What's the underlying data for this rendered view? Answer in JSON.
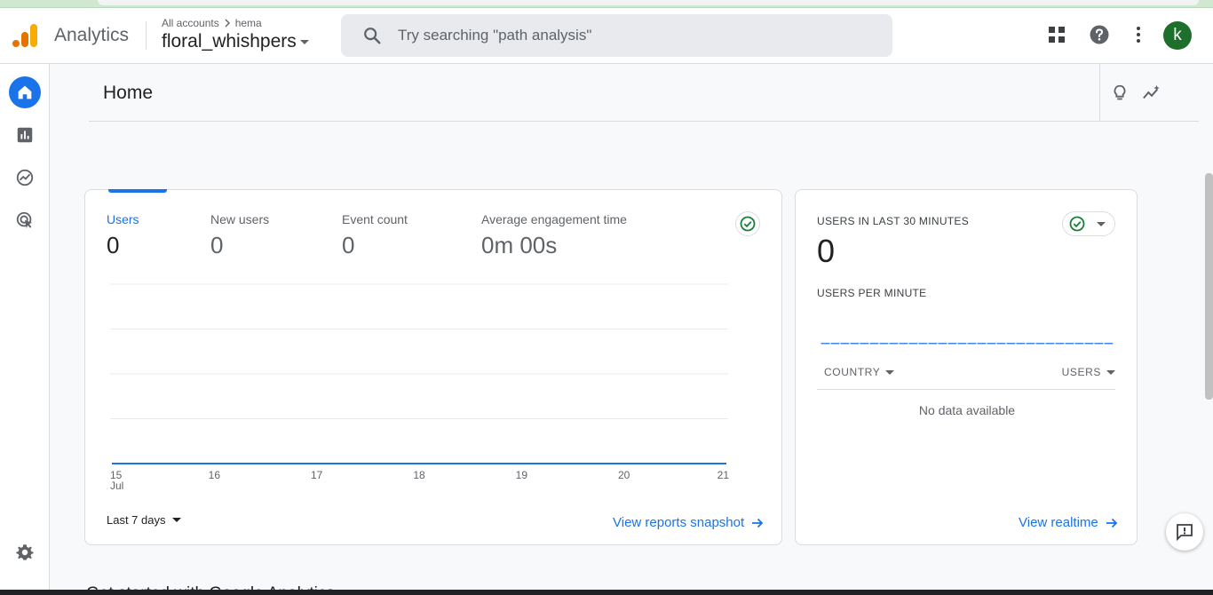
{
  "header": {
    "app_title": "Analytics",
    "breadcrumb": {
      "account": "All accounts",
      "sub": "hema"
    },
    "property": "floral_whishpers",
    "search": {
      "placeholder": "Try searching \"path analysis\""
    },
    "avatar_initial": "k"
  },
  "nav": {
    "items": [
      "home-icon",
      "reports-icon",
      "explore-icon",
      "advertising-icon"
    ],
    "settings": "gear-icon"
  },
  "page": {
    "title": "Home"
  },
  "overview": {
    "metrics": [
      {
        "label": "Users",
        "value": "0"
      },
      {
        "label": "New users",
        "value": "0"
      },
      {
        "label": "Event count",
        "value": "0"
      },
      {
        "label": "Average engagement time",
        "value": "0m 00s"
      }
    ],
    "range_label": "Last 7 days",
    "link": "View reports snapshot"
  },
  "chart_data": {
    "type": "line",
    "x": [
      "15",
      "16",
      "17",
      "18",
      "19",
      "20",
      "21"
    ],
    "x_sublabel": "Jul",
    "series": [
      {
        "values": [
          0,
          0,
          0,
          0,
          0,
          0,
          0
        ]
      }
    ],
    "grid": true,
    "color": "#1a73e8"
  },
  "realtime": {
    "title": "USERS IN LAST 30 MINUTES",
    "value": "0",
    "subtitle": "USERS PER MINUTE",
    "columns": [
      "COUNTRY",
      "USERS"
    ],
    "no_data": "No data available",
    "link": "View realtime"
  },
  "footer": {
    "partial_heading": "Get started with Google Analytics"
  },
  "colors": {
    "accent": "#1a73e8",
    "avatar": "#1e6f2c",
    "success": "#188038"
  }
}
